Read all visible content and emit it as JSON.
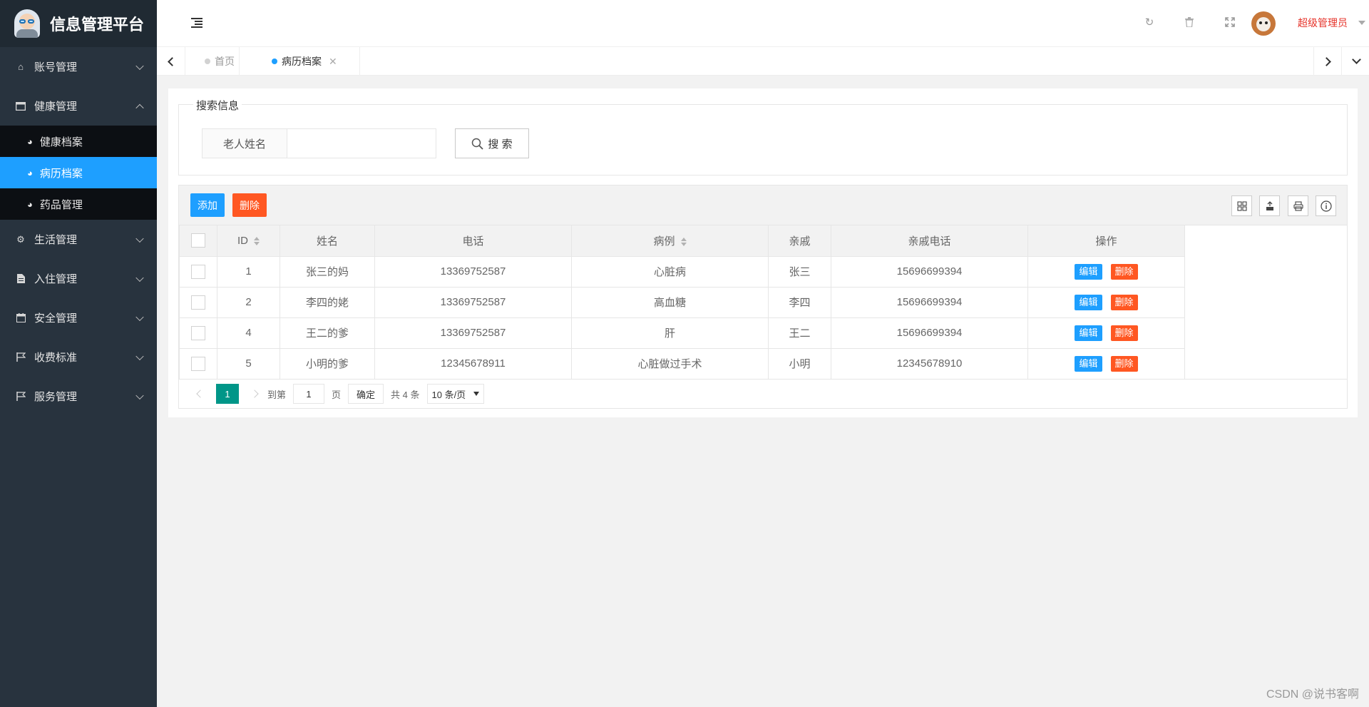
{
  "app": {
    "title": "信息管理平台"
  },
  "sidebar": {
    "items": [
      {
        "label": "账号管理",
        "icon": "home-icon",
        "expanded": false
      },
      {
        "label": "健康管理",
        "icon": "window-icon",
        "expanded": true,
        "children": [
          {
            "label": "健康档案",
            "icon": "dashboard-icon",
            "active": false
          },
          {
            "label": "病历档案",
            "icon": "dashboard-icon",
            "active": true
          },
          {
            "label": "药品管理",
            "icon": "dashboard-icon",
            "active": false
          }
        ]
      },
      {
        "label": "生活管理",
        "icon": "gears-icon",
        "expanded": false
      },
      {
        "label": "入住管理",
        "icon": "file-icon",
        "expanded": false
      },
      {
        "label": "安全管理",
        "icon": "calendar-icon",
        "expanded": false
      },
      {
        "label": "收费标准",
        "icon": "flag-icon",
        "expanded": false
      },
      {
        "label": "服务管理",
        "icon": "flag-icon",
        "expanded": false
      }
    ]
  },
  "header": {
    "user_name": "超级管理员",
    "icons": [
      "refresh-icon",
      "trash-icon",
      "fullscreen-icon"
    ]
  },
  "tabs": [
    {
      "label": "首页",
      "active": false
    },
    {
      "label": "病历档案",
      "active": true,
      "closable": true
    }
  ],
  "search": {
    "legend": "搜索信息",
    "field_label": "老人姓名",
    "input_value": "",
    "button_label": "搜 索"
  },
  "toolbar": {
    "add_label": "添加",
    "delete_label": "删除",
    "icons": [
      "columns-icon",
      "export-icon",
      "print-icon",
      "info-icon"
    ]
  },
  "table": {
    "columns": [
      "ID",
      "姓名",
      "电话",
      "病例",
      "亲戚",
      "亲戚电话",
      "操作"
    ],
    "rows": [
      {
        "id": "1",
        "name": "张三的妈",
        "phone": "13369752587",
        "case": "心脏病",
        "relative": "张三",
        "relative_phone": "15696699394"
      },
      {
        "id": "2",
        "name": "李四的姥",
        "phone": "13369752587",
        "case": "高血糖",
        "relative": "李四",
        "relative_phone": "15696699394"
      },
      {
        "id": "4",
        "name": "王二的爹",
        "phone": "13369752587",
        "case": "肝",
        "relative": "王二",
        "relative_phone": "15696699394"
      },
      {
        "id": "5",
        "name": "小明的爹",
        "phone": "12345678911",
        "case": "心脏做过手术",
        "relative": "小明",
        "relative_phone": "12345678910"
      }
    ],
    "edit_label": "编辑",
    "row_delete_label": "删除"
  },
  "pagination": {
    "current_page": "1",
    "goto_label": "到第",
    "goto_value": "1",
    "page_unit": "页",
    "confirm_label": "确定",
    "total_text": "共 4 条",
    "page_size": "10 条/页"
  },
  "watermark": "CSDN @说书客啊",
  "colors": {
    "sidebar": "#28333e",
    "logo_bg": "#202a33",
    "accent_blue": "#1e9fff",
    "danger_orange": "#ff5722",
    "pager_green": "#009688",
    "user_red": "#e6332a"
  }
}
